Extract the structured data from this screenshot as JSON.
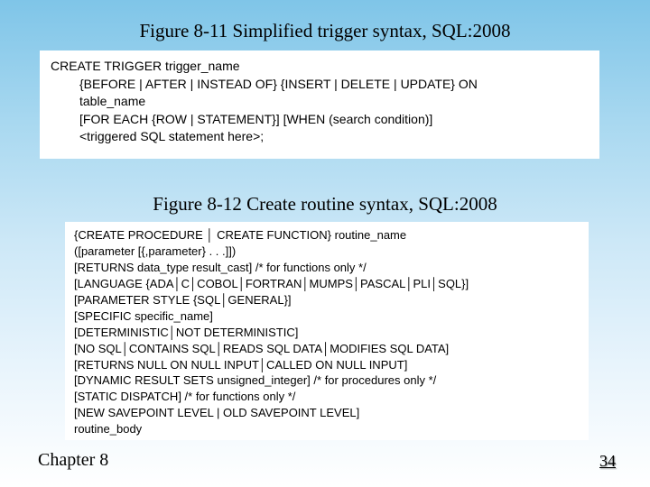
{
  "figure1": {
    "caption": "Figure 8-11 Simplified trigger syntax, SQL:2008",
    "lines": [
      "CREATE TRIGGER trigger_name",
      "{BEFORE | AFTER | INSTEAD OF} {INSERT | DELETE | UPDATE} ON",
      "table_name",
      "[FOR EACH {ROW | STATEMENT}] [WHEN (search condition)]",
      "<triggered SQL statement here>;"
    ]
  },
  "figure2": {
    "caption": "Figure 8-12 Create routine syntax, SQL:2008",
    "lines": [
      "{CREATE PROCEDURE │ CREATE FUNCTION} routine_name",
      "([parameter [{,parameter} . . .]])",
      "[RETURNS data_type result_cast]     /* for functions only */",
      "[LANGUAGE {ADA│C│COBOL│FORTRAN│MUMPS│PASCAL│PLI│SQL}]",
      "[PARAMETER STYLE {SQL│GENERAL}]",
      "[SPECIFIC specific_name]",
      "[DETERMINISTIC│NOT DETERMINISTIC]",
      "[NO SQL│CONTAINS SQL│READS SQL DATA│MODIFIES SQL DATA]",
      "[RETURNS NULL ON NULL INPUT│CALLED ON NULL INPUT]",
      "[DYNAMIC RESULT SETS unsigned_integer]           /* for procedures only */",
      "[STATIC DISPATCH]                                              /* for functions only */",
      "[NEW SAVEPOINT LEVEL | OLD SAVEPOINT LEVEL]",
      "routine_body"
    ]
  },
  "footer": {
    "chapter": "Chapter 8",
    "page": "34"
  }
}
